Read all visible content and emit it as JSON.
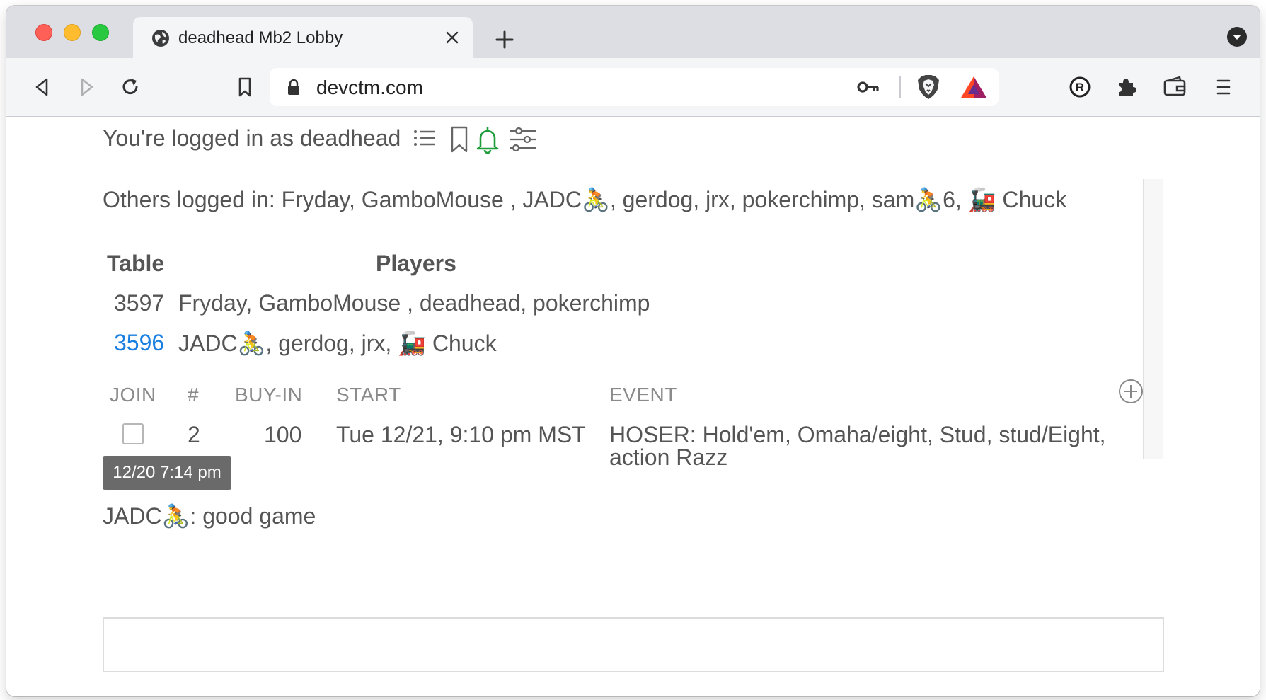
{
  "browser": {
    "tab_title": "deadhead Mb2 Lobby",
    "url": "devctm.com",
    "icons": [
      "globe-icon",
      "close-icon",
      "plus-icon",
      "tab-menu-icon",
      "back-icon",
      "forward-icon",
      "reload-icon",
      "bookmark-icon",
      "lock-icon",
      "key-icon",
      "brave-shields-icon",
      "bat-rewards-icon",
      "extension-r-icon",
      "puzzle-icon",
      "wallet-icon",
      "menu-icon"
    ]
  },
  "page": {
    "logged_in": "You're logged in as deadhead",
    "toolbar_icons": [
      "list-icon",
      "bookmark-icon",
      "bell-icon",
      "sliders-icon"
    ],
    "bell_color": "#1f9d3a",
    "others": "Others logged in: Fryday, GamboMouse , JADC🚴, gerdog, jrx, pokerchimp, sam🚴6, 🚂 Chuck",
    "tables": {
      "headers": {
        "table": "Table",
        "players": "Players"
      },
      "rows": [
        {
          "id": "3597",
          "players": "Fryday, GamboMouse , deadhead, pokerchimp",
          "linked": false
        },
        {
          "id": "3596",
          "players": "JADC🚴, gerdog, jrx, 🚂 Chuck",
          "linked": true
        }
      ]
    },
    "tournaments": {
      "headers": {
        "join": "JOIN",
        "num": "#",
        "buyin": "BUY-IN",
        "start": "START",
        "event": "EVENT"
      },
      "rows": [
        {
          "joined": false,
          "num": "2",
          "buyin": "100",
          "start": "Tue 12/21, 9:10 pm MST",
          "event_line1": "HOSER: Hold'em, Omaha/eight, Stud, stud/Eight,",
          "event_line2": "action Razz"
        }
      ]
    },
    "tooltip": "12/20 7:14 pm",
    "chat_message": "JADC🚴: good game",
    "chat_input": {
      "value": "",
      "placeholder": ""
    },
    "link_color": "#1a7fe0"
  }
}
